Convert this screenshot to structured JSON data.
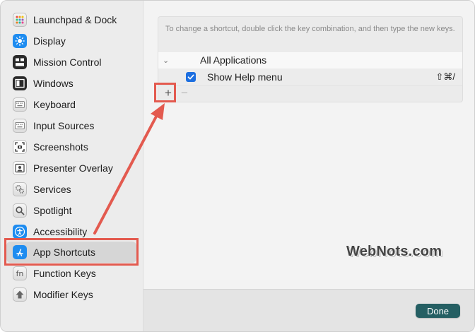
{
  "sidebar": {
    "items": [
      {
        "label": "Launchpad & Dock",
        "icon": "launchpad-icon"
      },
      {
        "label": "Display",
        "icon": "display-icon"
      },
      {
        "label": "Mission Control",
        "icon": "mission-control-icon"
      },
      {
        "label": "Windows",
        "icon": "windows-icon"
      },
      {
        "label": "Keyboard",
        "icon": "keyboard-icon"
      },
      {
        "label": "Input Sources",
        "icon": "input-sources-icon"
      },
      {
        "label": "Screenshots",
        "icon": "screenshots-icon"
      },
      {
        "label": "Presenter Overlay",
        "icon": "presenter-overlay-icon"
      },
      {
        "label": "Services",
        "icon": "services-icon"
      },
      {
        "label": "Spotlight",
        "icon": "spotlight-icon"
      },
      {
        "label": "Accessibility",
        "icon": "accessibility-icon"
      },
      {
        "label": "App Shortcuts",
        "icon": "app-shortcuts-icon",
        "selected": true
      },
      {
        "label": "Function Keys",
        "icon": "function-keys-icon"
      },
      {
        "label": "Modifier Keys",
        "icon": "modifier-keys-icon"
      }
    ]
  },
  "main": {
    "hint": "To change a shortcut, double click the key combination, and then type the new keys.",
    "group_label": "All Applications",
    "item": {
      "label": "Show Help menu",
      "keys": "⇧⌘/",
      "checked": true
    },
    "add_symbol": "+",
    "remove_symbol": "−"
  },
  "footer": {
    "done_label": "Done"
  },
  "watermark": "WebNots.com",
  "colors": {
    "accent": "#1d6fe0",
    "done": "#255f63",
    "annotation": "#e35a4f"
  }
}
